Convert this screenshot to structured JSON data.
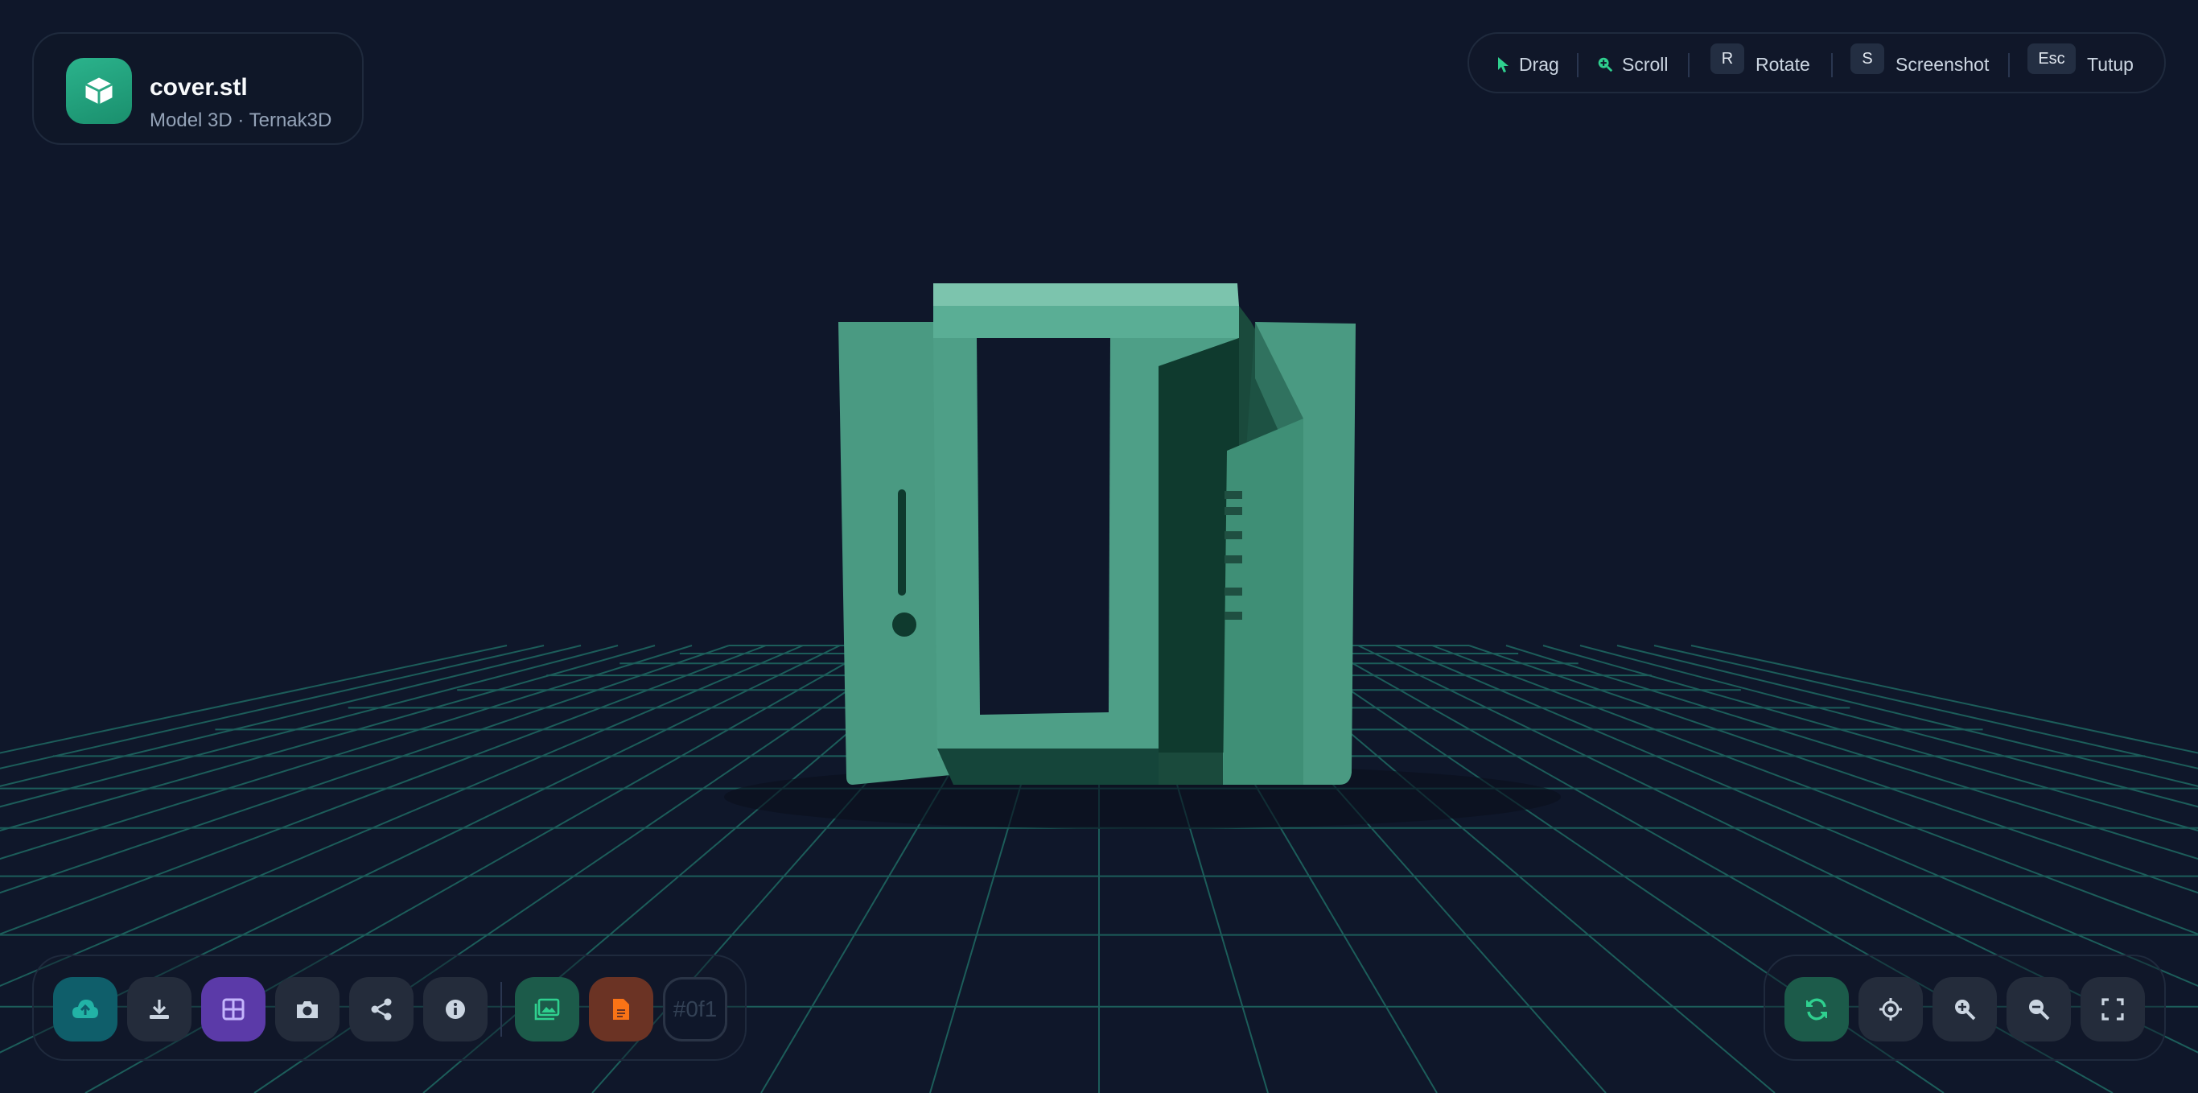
{
  "header": {
    "file_name": "cover.stl",
    "subtitle": "Model 3D · Ternak3D",
    "icon": "cube-icon"
  },
  "hints": [
    {
      "icon": "cursor-icon",
      "label": "Drag"
    },
    {
      "icon": "zoom-icon",
      "label": "Scroll"
    },
    {
      "key": "R",
      "label": "Rotate"
    },
    {
      "key": "S",
      "label": "Screenshot"
    },
    {
      "key": "Esc",
      "label": "Tutup"
    }
  ],
  "left_toolbar": {
    "buttons": [
      {
        "name": "upload-button",
        "icon": "cloud-upload-icon",
        "color": "#22b3a6",
        "bg": "#0f5e6a"
      },
      {
        "name": "download-button",
        "icon": "download-icon",
        "color": "#cbd5e1",
        "bg": "#242c3b"
      },
      {
        "name": "grid-toggle-button",
        "icon": "grid-icon",
        "color": "#c4b5fd",
        "bg": "#5b3aa8"
      },
      {
        "name": "camera-button",
        "icon": "camera-icon",
        "color": "#cbd5e1",
        "bg": "#242c3b"
      },
      {
        "name": "share-button",
        "icon": "share-icon",
        "color": "#cbd5e1",
        "bg": "#242c3b"
      },
      {
        "name": "info-button",
        "icon": "info-icon",
        "color": "#cbd5e1",
        "bg": "#242c3b"
      },
      {
        "name": "export-image-button",
        "icon": "image-icon",
        "color": "#2fd08f",
        "bg": "#1c5b4a"
      },
      {
        "name": "export-pdf-button",
        "icon": "file-icon",
        "color": "#f97316",
        "bg": "#6b3324"
      }
    ],
    "color_value": "#0f1"
  },
  "right_toolbar": {
    "buttons": [
      {
        "name": "auto-rotate-button",
        "icon": "refresh-icon",
        "color": "#2fd08f",
        "bg": "#1c5b4a"
      },
      {
        "name": "center-button",
        "icon": "crosshair-icon",
        "color": "#cbd5e1",
        "bg": "#242c3b"
      },
      {
        "name": "zoom-in-button",
        "icon": "zoom-in-icon",
        "color": "#cbd5e1",
        "bg": "#242c3b"
      },
      {
        "name": "zoom-out-button",
        "icon": "zoom-out-icon",
        "color": "#cbd5e1",
        "bg": "#242c3b"
      },
      {
        "name": "fullscreen-button",
        "icon": "fullscreen-icon",
        "color": "#cbd5e1",
        "bg": "#242c3b"
      }
    ]
  },
  "scene": {
    "background": "#0f172a",
    "grid_color": "#1f6a63",
    "model_color": "#4a9a82"
  }
}
